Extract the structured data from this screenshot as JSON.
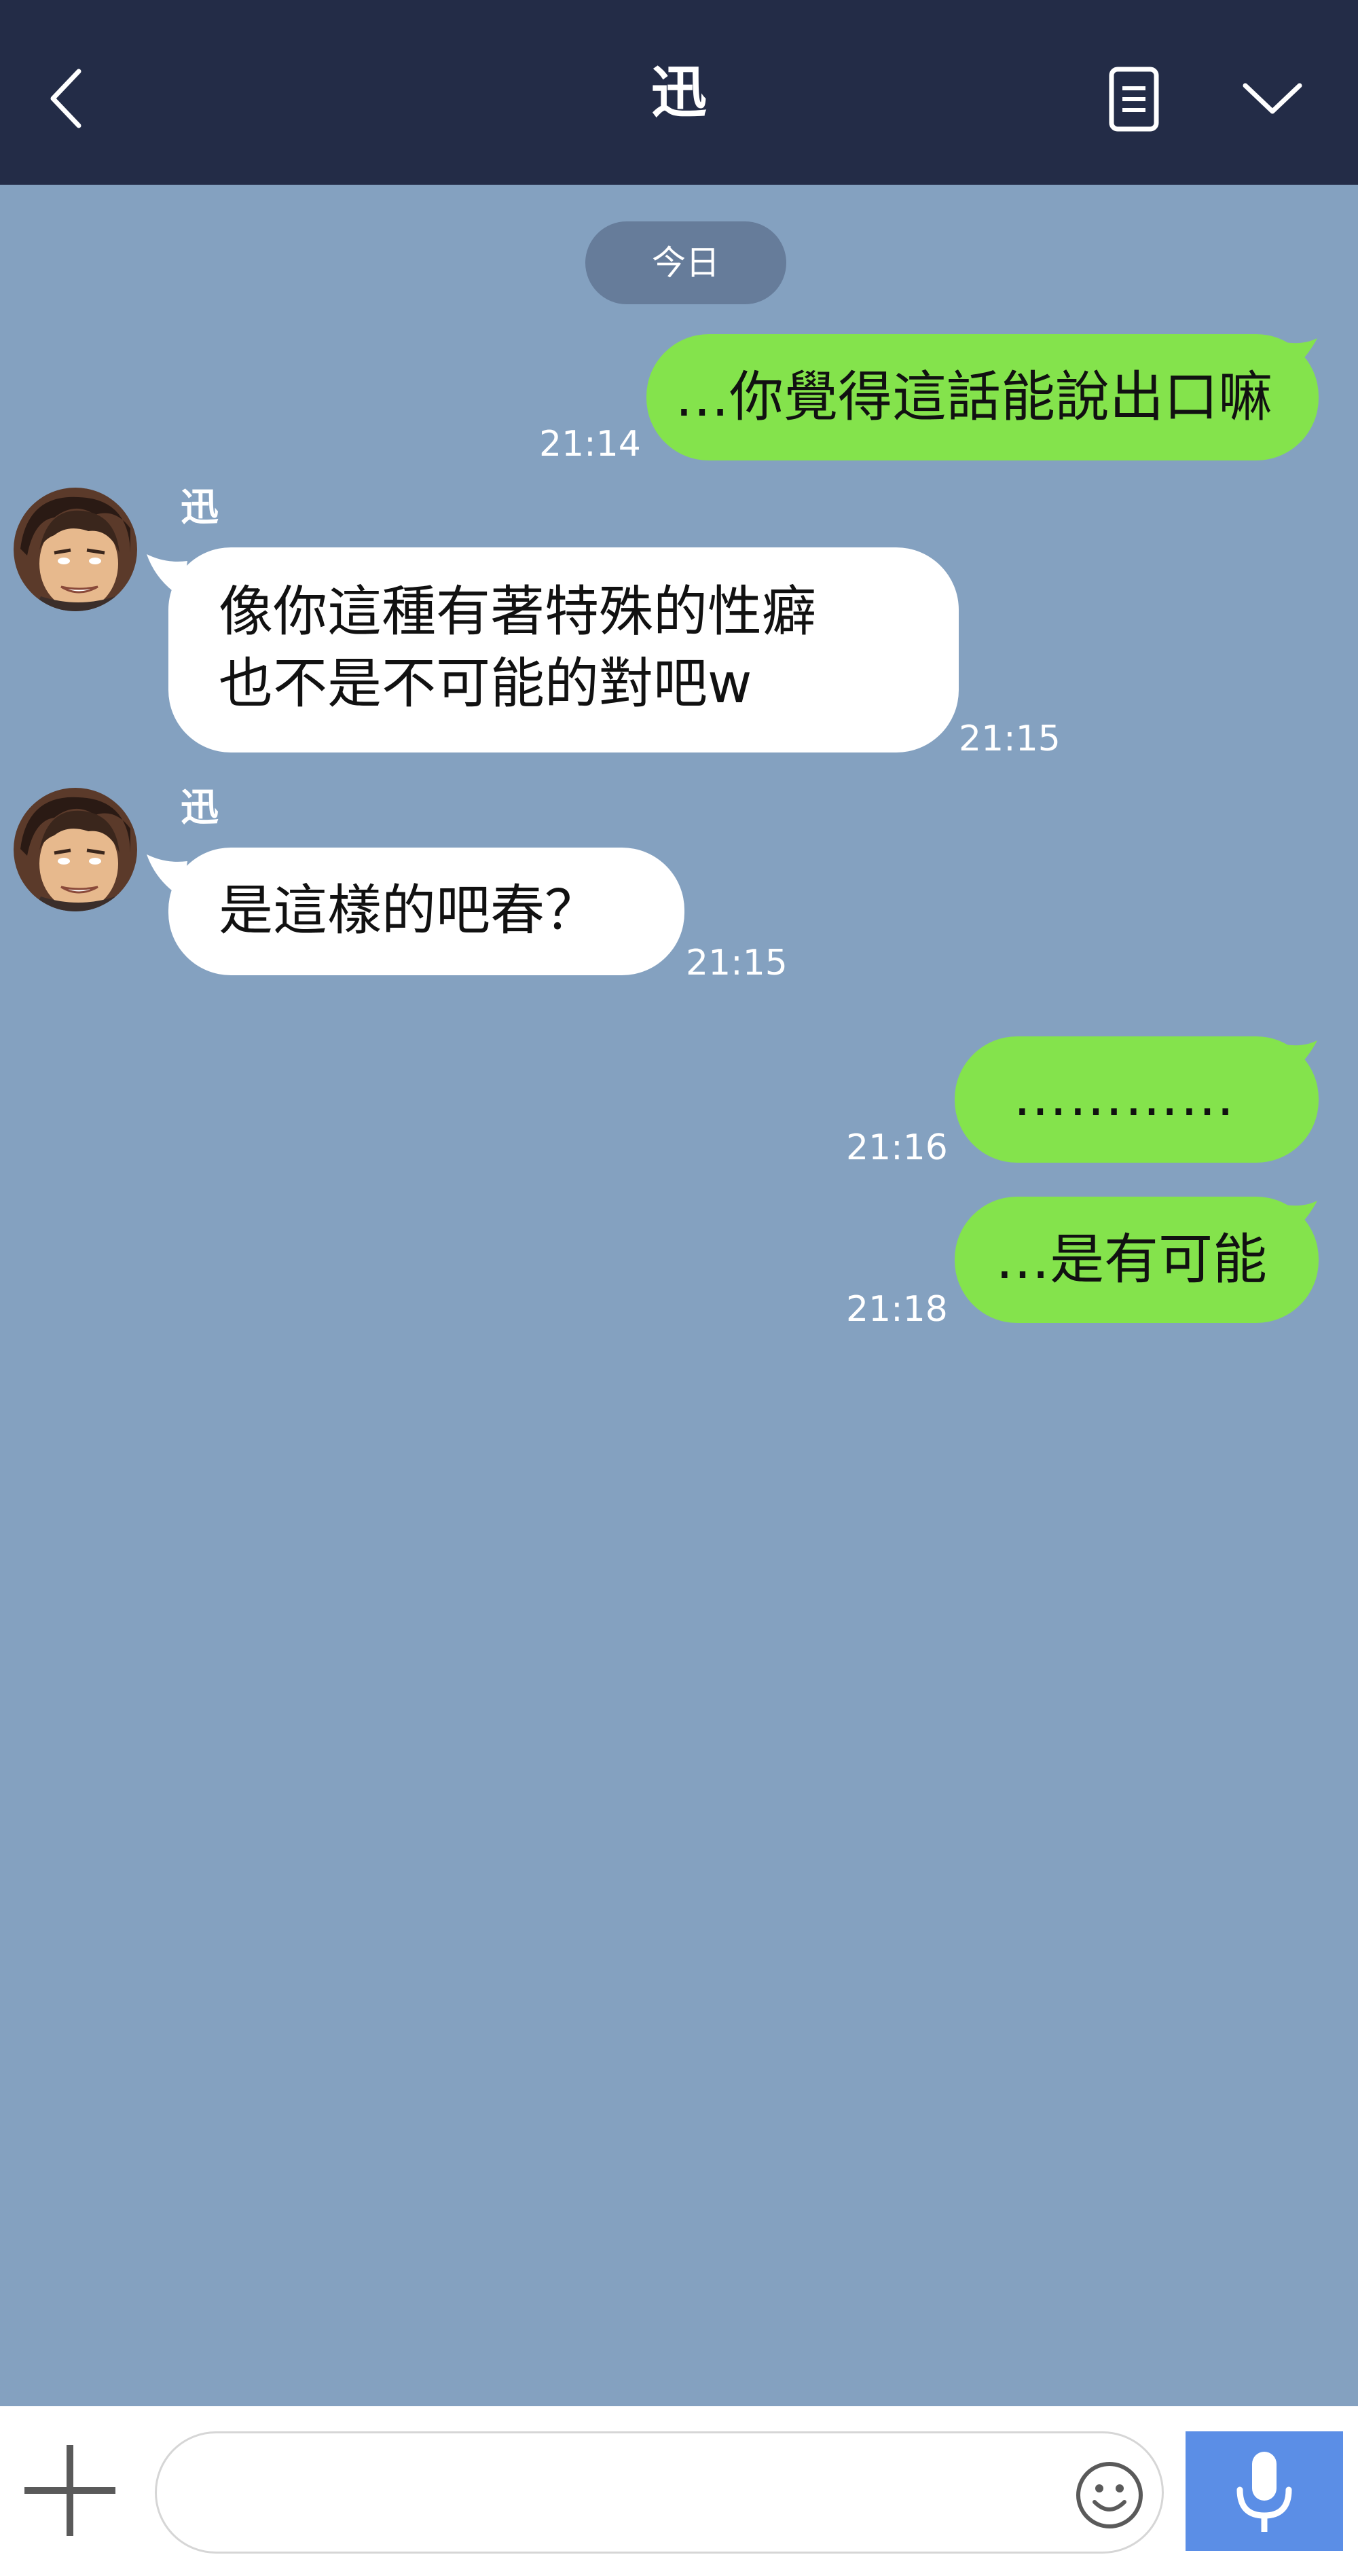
{
  "header": {
    "title": "迅"
  },
  "date_divider": "今日",
  "messages": [
    {
      "side": "out",
      "text": "…你覺得這話能說出口嘛",
      "time": "21:14"
    },
    {
      "side": "in",
      "sender": "迅",
      "lines": [
        "像你這種有著特殊的性癖",
        "也不是不可能的對吧w"
      ],
      "time": "21:15"
    },
    {
      "side": "in",
      "sender": "迅",
      "text": "是這樣的吧春？",
      "time": "21:15"
    },
    {
      "side": "out",
      "text": "…………",
      "time": "21:16"
    },
    {
      "side": "out",
      "text": "…是有可能",
      "time": "21:18"
    }
  ],
  "composer": {
    "placeholder": "",
    "value": ""
  },
  "colors": {
    "header_bg": "#232c47",
    "chat_bg": "#84a1c0",
    "outgoing_bubble": "#84e34c",
    "incoming_bubble": "#ffffff",
    "date_pill": "#667c9a",
    "mic_button": "#5b8ee6"
  },
  "icons": {
    "back": "chevron-left-icon",
    "notes": "document-icon",
    "menu": "chevron-down-icon",
    "add": "plus-icon",
    "emoji": "smiley-icon",
    "voice": "microphone-icon"
  }
}
